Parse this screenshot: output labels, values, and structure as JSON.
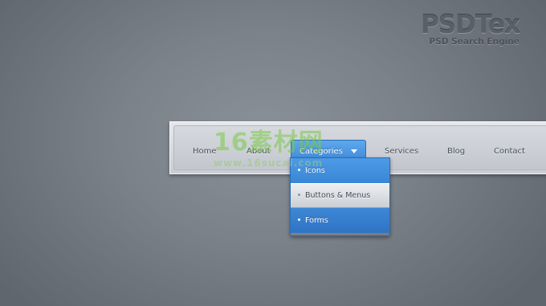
{
  "logo": {
    "title": "PSDTex",
    "subtitle": "PSD Search Engine"
  },
  "watermark": {
    "main": "16素材网",
    "url": "www.16sucai.com"
  },
  "nav": {
    "items": [
      {
        "label": "Home"
      },
      {
        "label": "About"
      },
      {
        "label": "Categories",
        "active": true,
        "caret_icon": "chevron-down-icon"
      },
      {
        "label": "Services"
      },
      {
        "label": "Blog"
      },
      {
        "label": "Contact"
      }
    ]
  },
  "dropdown": {
    "items": [
      {
        "label": "Icons",
        "state": "default"
      },
      {
        "label": "Buttons & Menus",
        "state": "highlighted"
      },
      {
        "label": "Forms",
        "state": "default"
      }
    ]
  },
  "colors": {
    "accent": "#3d87d6",
    "bar": "#d6d9de",
    "background": "#7a8189",
    "nav_text": "#4a5058"
  }
}
